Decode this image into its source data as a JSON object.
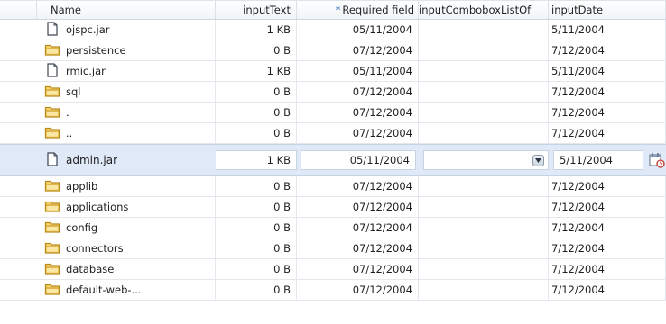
{
  "columns": {
    "name": "Name",
    "size": "inputText",
    "date_required_marker": "*",
    "date": "Required field",
    "combo": "inputComboboxListOf",
    "idate": "inputDate"
  },
  "rows": [
    {
      "name": "ojspc.jar",
      "icon": "file-icon",
      "size": "1 KB",
      "date": "05/11/2004",
      "idate": "5/11/2004"
    },
    {
      "name": "persistence",
      "icon": "folder-icon",
      "size": "0 B",
      "date": "07/12/2004",
      "idate": "7/12/2004"
    },
    {
      "name": "rmic.jar",
      "icon": "file-icon",
      "size": "1 KB",
      "date": "05/11/2004",
      "idate": "5/11/2004"
    },
    {
      "name": "sql",
      "icon": "folder-icon",
      "size": "0 B",
      "date": "07/12/2004",
      "idate": "7/12/2004"
    },
    {
      "name": ".",
      "icon": "folder-icon",
      "size": "0 B",
      "date": "07/12/2004",
      "idate": "7/12/2004"
    },
    {
      "name": "..",
      "icon": "folder-icon",
      "size": "0 B",
      "date": "07/12/2004",
      "idate": "7/12/2004"
    }
  ],
  "selected_row": {
    "name": "admin.jar",
    "icon": "file-icon",
    "size": "1 KB",
    "date": "05/11/2004",
    "combo": "",
    "idate": "5/11/2004"
  },
  "rows_after": [
    {
      "name": "applib",
      "icon": "folder-icon",
      "size": "0 B",
      "date": "07/12/2004",
      "idate": "7/12/2004"
    },
    {
      "name": "applications",
      "icon": "folder-icon",
      "size": "0 B",
      "date": "07/12/2004",
      "idate": "7/12/2004"
    },
    {
      "name": "config",
      "icon": "folder-icon",
      "size": "0 B",
      "date": "07/12/2004",
      "idate": "7/12/2004"
    },
    {
      "name": "connectors",
      "icon": "folder-icon",
      "size": "0 B",
      "date": "07/12/2004",
      "idate": "7/12/2004"
    },
    {
      "name": "database",
      "icon": "folder-icon",
      "size": "0 B",
      "date": "07/12/2004",
      "idate": "7/12/2004"
    },
    {
      "name": "default-web-...",
      "icon": "folder-icon",
      "size": "0 B",
      "date": "07/12/2004",
      "idate": "7/12/2004"
    }
  ],
  "colors": {
    "selected_row_bg": "#dfe9f7",
    "folder_fill": "#f6d36b",
    "folder_stroke": "#b98a1d",
    "required_marker": "#1a5fb4"
  }
}
